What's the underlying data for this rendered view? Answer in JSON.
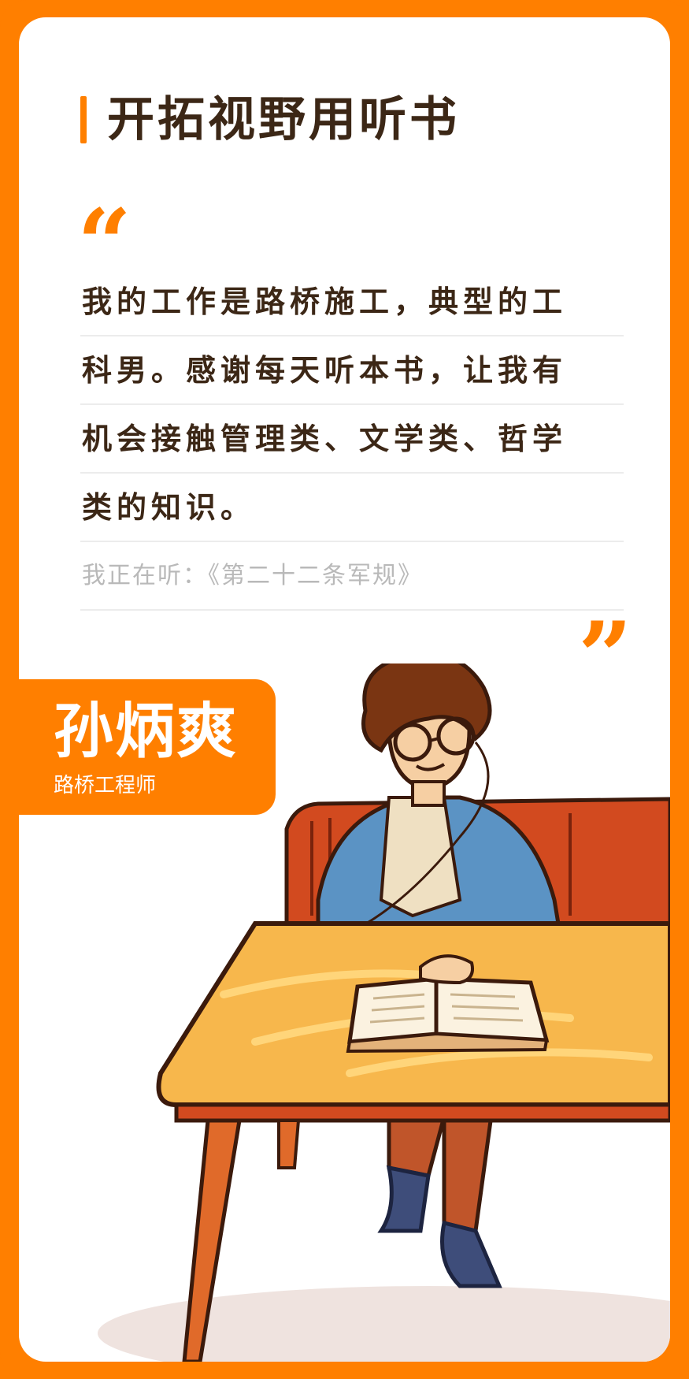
{
  "header": {
    "title": "开拓视野用听书"
  },
  "quote": {
    "open_mark": "“",
    "close_mark": "”",
    "lines": [
      "我的工作是路桥施工，典型的工",
      "科男。感谢每天听本书，让我有",
      "机会接触管理类、文学类、哲学",
      "类的知识。"
    ],
    "listening": "我正在听：《第二十二条军规》"
  },
  "person": {
    "name": "孙炳爽",
    "role": "路桥工程师"
  },
  "colors": {
    "accent": "#ff7f00",
    "text": "#3c2716",
    "muted": "#b9b9b9"
  },
  "illustration": {
    "subject": "man-with-glasses-reading-book-at-table"
  }
}
